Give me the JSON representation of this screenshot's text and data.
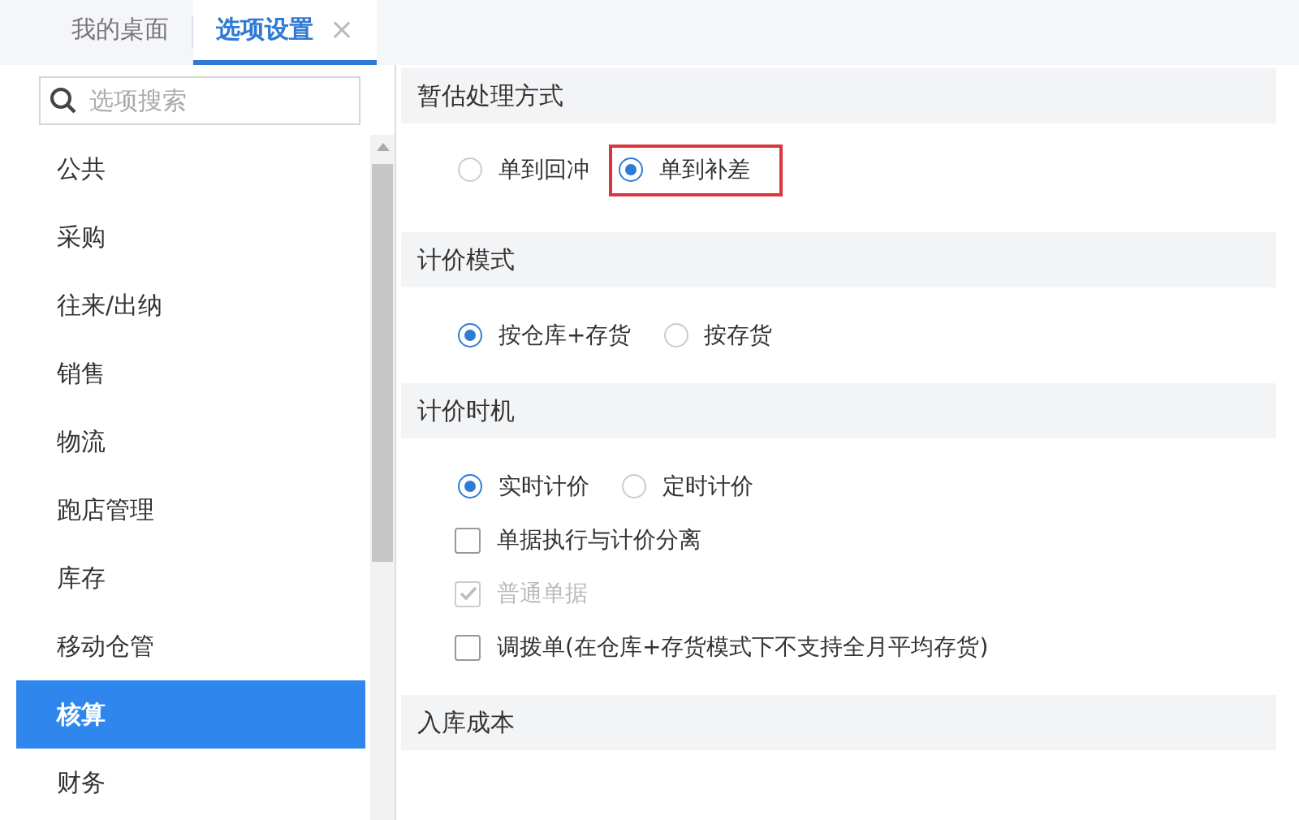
{
  "tabs": [
    {
      "label": "我的桌面",
      "selected": false
    },
    {
      "label": "选项设置",
      "selected": true,
      "close_symbol": "×"
    }
  ],
  "sidebar": {
    "search": {
      "placeholder": "选项搜索"
    },
    "items": [
      {
        "label": "公共",
        "selected": false
      },
      {
        "label": "采购",
        "selected": false
      },
      {
        "label": "往来/出纳",
        "selected": false
      },
      {
        "label": "销售",
        "selected": false
      },
      {
        "label": "物流",
        "selected": false
      },
      {
        "label": "跑店管理",
        "selected": false
      },
      {
        "label": "库存",
        "selected": false
      },
      {
        "label": "移动仓管",
        "selected": false
      },
      {
        "label": "核算",
        "selected": true
      },
      {
        "label": "财务",
        "selected": false
      }
    ]
  },
  "sections": [
    {
      "title": "暂估处理方式",
      "rows": [
        {
          "kind": "radio",
          "options": [
            {
              "label": "单到回冲",
              "selected": false,
              "highlighted": false
            },
            {
              "label": "单到补差",
              "selected": true,
              "highlighted": true
            }
          ]
        }
      ]
    },
    {
      "title": "计价模式",
      "rows": [
        {
          "kind": "radio",
          "options": [
            {
              "label": "按仓库+存货",
              "selected": true,
              "highlighted": false
            },
            {
              "label": "按存货",
              "selected": false,
              "highlighted": false
            }
          ]
        }
      ]
    },
    {
      "title": "计价时机",
      "rows": [
        {
          "kind": "radio",
          "options": [
            {
              "label": "实时计价",
              "selected": true,
              "highlighted": false
            },
            {
              "label": "定时计价",
              "selected": false,
              "highlighted": false
            }
          ]
        },
        {
          "kind": "checkbox",
          "label": "单据执行与计价分离",
          "checked": false,
          "disabled": false
        },
        {
          "kind": "checkbox",
          "label": "普通单据",
          "checked": true,
          "disabled": true
        },
        {
          "kind": "checkbox",
          "label": "调拨单(在仓库+存货模式下不支持全月平均存货)",
          "checked": false,
          "disabled": false
        }
      ]
    },
    {
      "title": "入库成本"
    }
  ]
}
